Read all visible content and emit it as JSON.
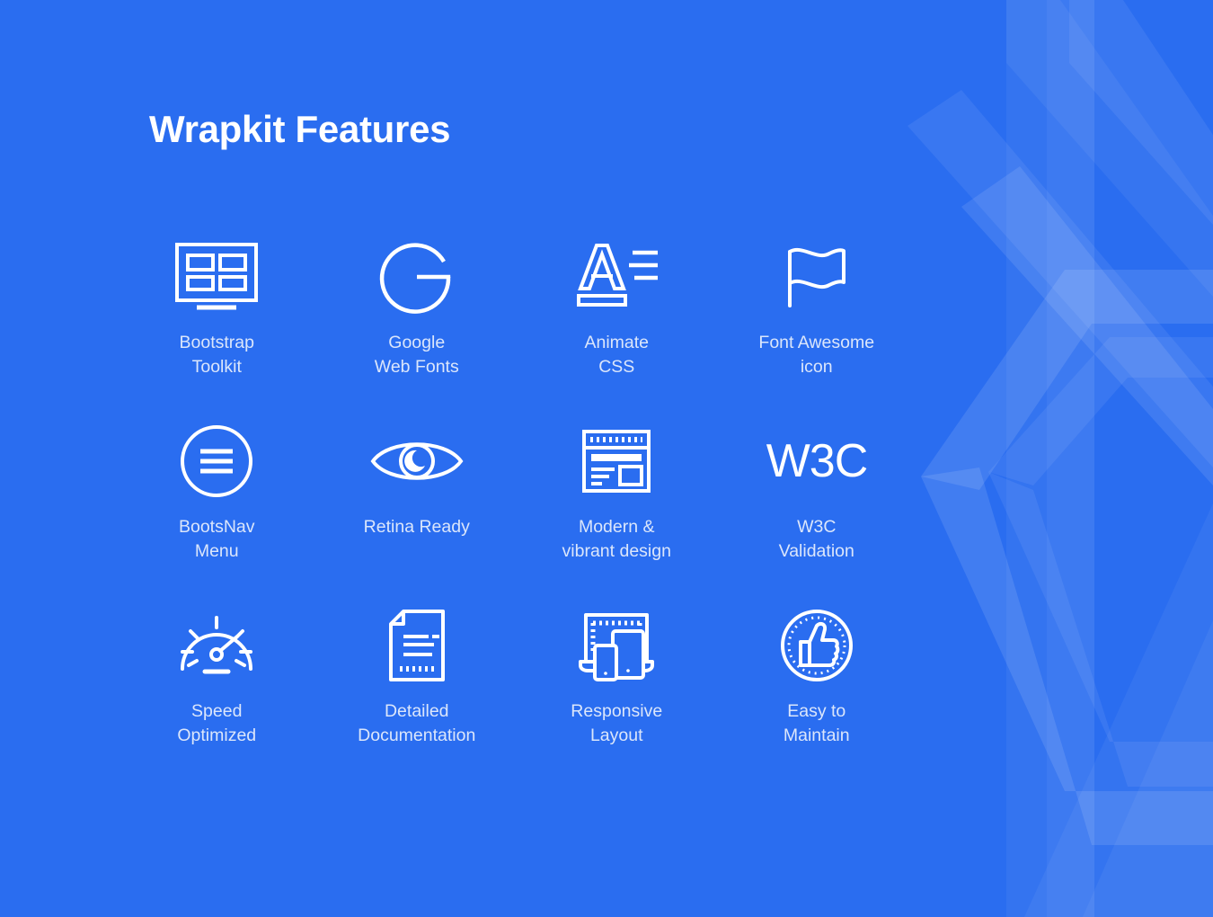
{
  "slide": {
    "title": "Wrapkit Features",
    "background_color": "#2a6df0",
    "label_color": "#dbe6fb",
    "icon_color": "#ffffff",
    "decor_color": "#5b92f5"
  },
  "features": [
    {
      "icon": "bootstrap-screen-grid-icon",
      "label": "Bootstrap\nToolkit"
    },
    {
      "icon": "google-g-icon",
      "label": "Google\nWeb Fonts"
    },
    {
      "icon": "animate-letter-a-icon",
      "label": "Animate\nCSS"
    },
    {
      "icon": "flag-icon",
      "label": "Font Awesome\nicon"
    },
    {
      "icon": "hamburger-menu-circle-icon",
      "label": "BootsNav\nMenu"
    },
    {
      "icon": "eye-icon",
      "label": "Retina Ready"
    },
    {
      "icon": "browser-window-icon",
      "label": "Modern &\nvibrant design"
    },
    {
      "icon": "w3c-logo-icon",
      "label": "W3C\nValidation"
    },
    {
      "icon": "speedometer-icon",
      "label": "Speed\nOptimized"
    },
    {
      "icon": "document-page-icon",
      "label": "Detailed\nDocumentation"
    },
    {
      "icon": "responsive-devices-icon",
      "label": "Responsive\nLayout"
    },
    {
      "icon": "thumbs-up-circle-icon",
      "label": "Easy to\nMaintain"
    }
  ]
}
